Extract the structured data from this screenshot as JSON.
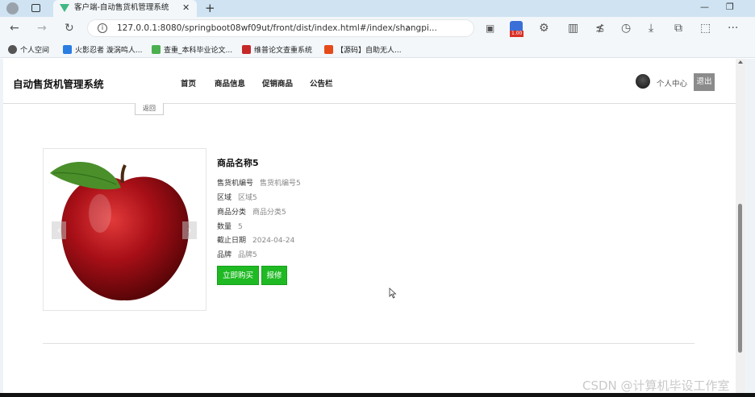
{
  "browser": {
    "tab_title": "客户端-自动售货机管理系统",
    "tab_close": "✕",
    "new_tab": "+",
    "url": "127.0.0.1:8080/springboot08wf09ut/front/dist/index.html#/index/shangpi...",
    "zoom_badge": "1.00",
    "bookmarks": [
      {
        "label": "个人空间",
        "color": "#555555"
      },
      {
        "label": "火影忍者 漩涡鸣人...",
        "color": "#2a7de1"
      },
      {
        "label": "查重_本科毕业论文...",
        "color": "#4caf50"
      },
      {
        "label": "维普论文查重系统",
        "color": "#c62828"
      },
      {
        "label": "【源码】自助无人...",
        "color": "#e64a19"
      }
    ]
  },
  "header": {
    "brand": "自动售货机管理系统",
    "nav": [
      "首页",
      "商品信息",
      "促销商品",
      "公告栏"
    ],
    "user_center": "个人中心",
    "logout": "退出"
  },
  "back_label": "返回",
  "product": {
    "name": "商品名称5",
    "fields": [
      {
        "label": "售货机编号",
        "value": "售货机编号5"
      },
      {
        "label": "区域",
        "value": "区域5"
      },
      {
        "label": "商品分类",
        "value": "商品分类5"
      },
      {
        "label": "数量",
        "value": "5"
      },
      {
        "label": "截止日期",
        "value": "2024-04-24"
      },
      {
        "label": "品牌",
        "value": "品牌5"
      }
    ],
    "buy_label": "立即购买",
    "repair_label": "报修",
    "carousel_prev": "‹",
    "carousel_next": "›"
  },
  "watermark": "CSDN @计算机毕设工作室",
  "colors": {
    "primary_green": "#1fba23",
    "logout_gray": "#8b8b8b"
  }
}
